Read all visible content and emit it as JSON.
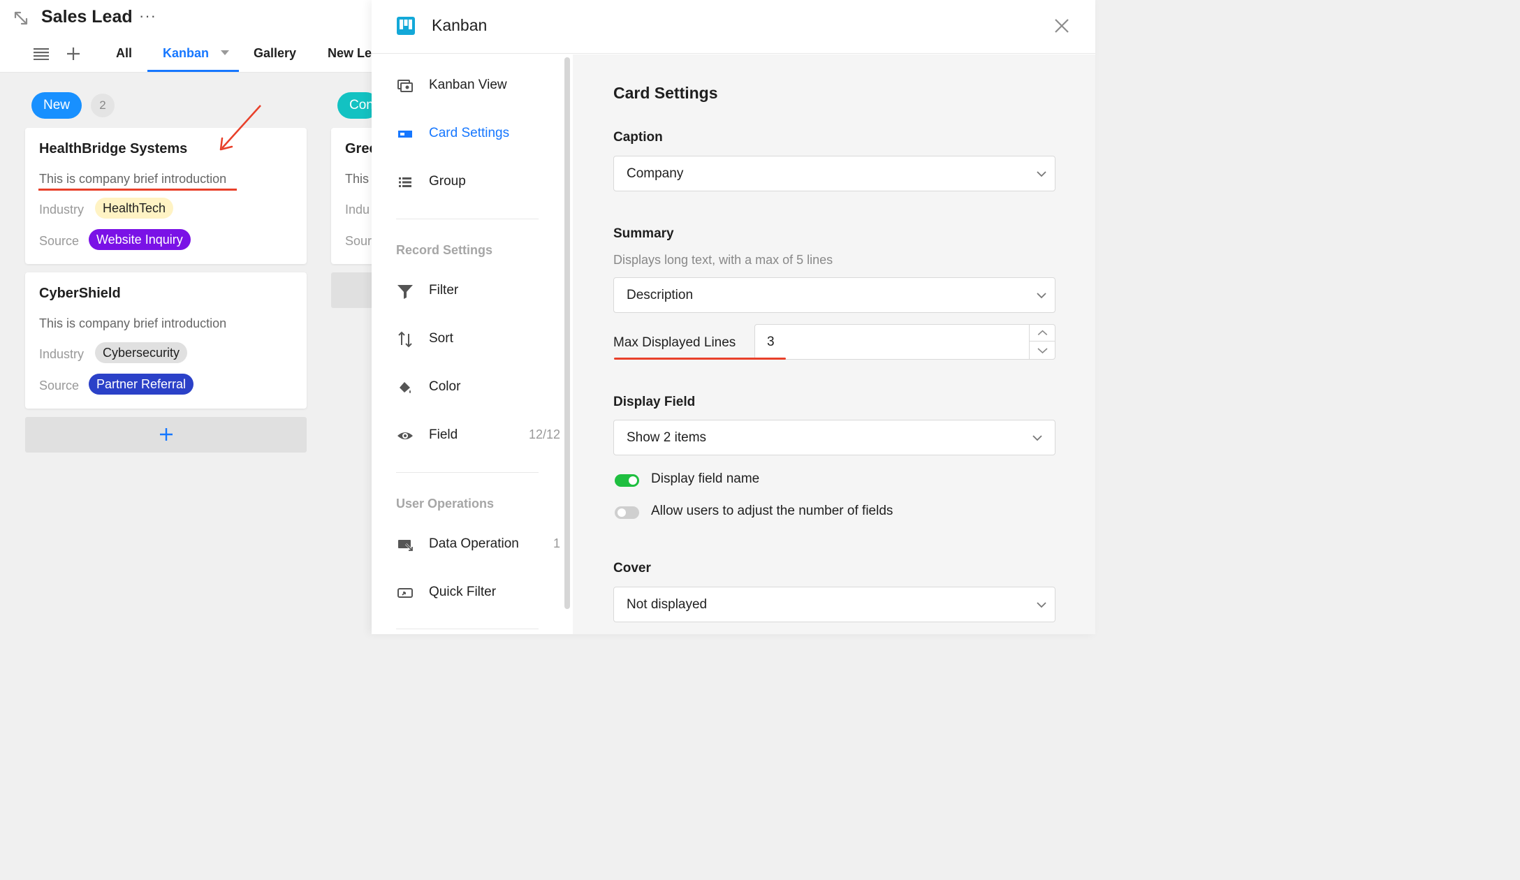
{
  "app": {
    "title": "Sales Lead",
    "more": "···",
    "tabs": {
      "all": "All",
      "kanban": "Kanban",
      "gallery": "Gallery",
      "new_lead": "New Le"
    }
  },
  "board": {
    "columns": [
      {
        "name": "New",
        "count": "2"
      },
      {
        "name": "Con"
      }
    ],
    "cards": [
      {
        "title": "HealthBridge Systems",
        "desc": "This is company brief introduction",
        "industry_label": "Industry",
        "industry": "HealthTech",
        "source_label": "Source",
        "source": "Website Inquiry"
      },
      {
        "title": "CyberShield",
        "desc": "This is company brief introduction",
        "industry_label": "Industry",
        "industry": "Cybersecurity",
        "source_label": "Source",
        "source": "Partner Referral"
      },
      {
        "title": "Gree",
        "desc": "This",
        "industry_label": "Indu",
        "source_label": "Sour"
      }
    ],
    "colors": {
      "new": "#1890ff",
      "con": "#13c2c2",
      "healthtech_bg": "#fff3c4",
      "website_bg": "#7a12e6",
      "cyber_bg": "#e0e0e0",
      "partner_bg": "#2b41c8",
      "annotation": "#e8402a"
    }
  },
  "drawer": {
    "title": "Kanban",
    "nav": {
      "kanban_view": "Kanban View",
      "card_settings": "Card Settings",
      "group": "Group",
      "record_settings": "Record Settings",
      "filter": "Filter",
      "sort": "Sort",
      "color": "Color",
      "field": "Field",
      "field_count": "12/12",
      "user_operations": "User Operations",
      "data_operation": "Data Operation",
      "data_operation_count": "1",
      "quick_filter": "Quick Filter"
    },
    "settings": {
      "heading": "Card Settings",
      "caption_label": "Caption",
      "caption_value": "Company",
      "summary_label": "Summary",
      "summary_hint": "Displays long text, with a max of 5 lines",
      "summary_value": "Description",
      "max_lines_label": "Max Displayed Lines",
      "max_lines_value": "3",
      "display_field_label": "Display Field",
      "display_field_value": "Show 2 items",
      "toggle_field_name": "Display field name",
      "toggle_field_name_on": true,
      "toggle_adjust": "Allow users to adjust the number of fields",
      "toggle_adjust_on": false,
      "cover_label": "Cover",
      "cover_value": "Not displayed"
    }
  }
}
